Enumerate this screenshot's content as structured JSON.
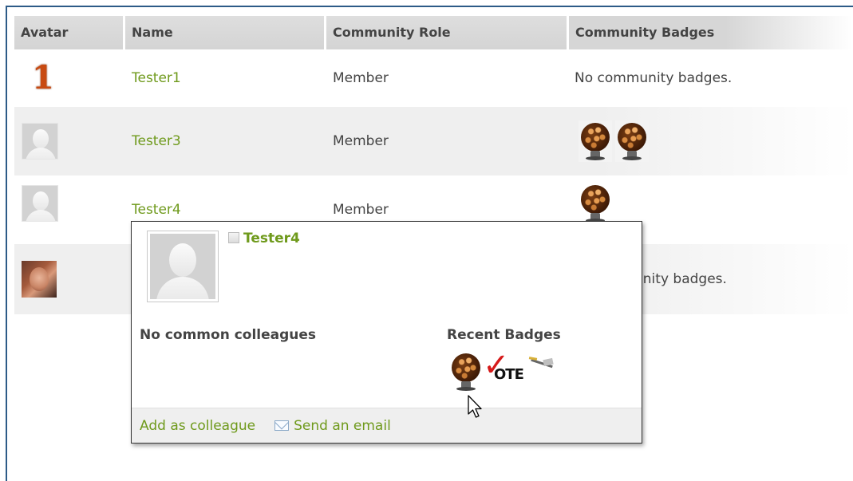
{
  "table": {
    "headers": {
      "avatar": "Avatar",
      "name": "Name",
      "role": "Community Role",
      "badges": "Community Badges"
    },
    "rows": [
      {
        "avatar": "number-one-avatar",
        "name": "Tester1",
        "role": "Member",
        "badges_text": "No community badges.",
        "badge_icons": []
      },
      {
        "avatar": "default-person-avatar",
        "name": "Tester3",
        "role": "Member",
        "badges_text": "",
        "badge_icons": [
          "globe-badge-icon",
          "globe-badge-icon"
        ]
      },
      {
        "avatar": "default-person-avatar",
        "name": "Tester4",
        "role": "Member",
        "badges_text": "",
        "badge_icons": [
          "globe-badge-icon"
        ]
      },
      {
        "avatar": "user-photo-avatar",
        "name": "",
        "role": "",
        "badges_text": "unity badges.",
        "badge_icons": []
      }
    ]
  },
  "hover_card": {
    "name": "Tester4",
    "colleagues_text": "No common colleagues",
    "recent_badges_label": "Recent Badges",
    "recent_badges": [
      "globe-badge-icon",
      "vote-badge-icon",
      "pen-badge-icon"
    ],
    "vote_word": "OTE",
    "footer": {
      "add_colleague": "Add as colleague",
      "send_email": "Send an email"
    }
  },
  "colors": {
    "link_green": "#6f9a1c",
    "frame_blue": "#2d5b87",
    "header_gray": "#d6d6d6"
  }
}
